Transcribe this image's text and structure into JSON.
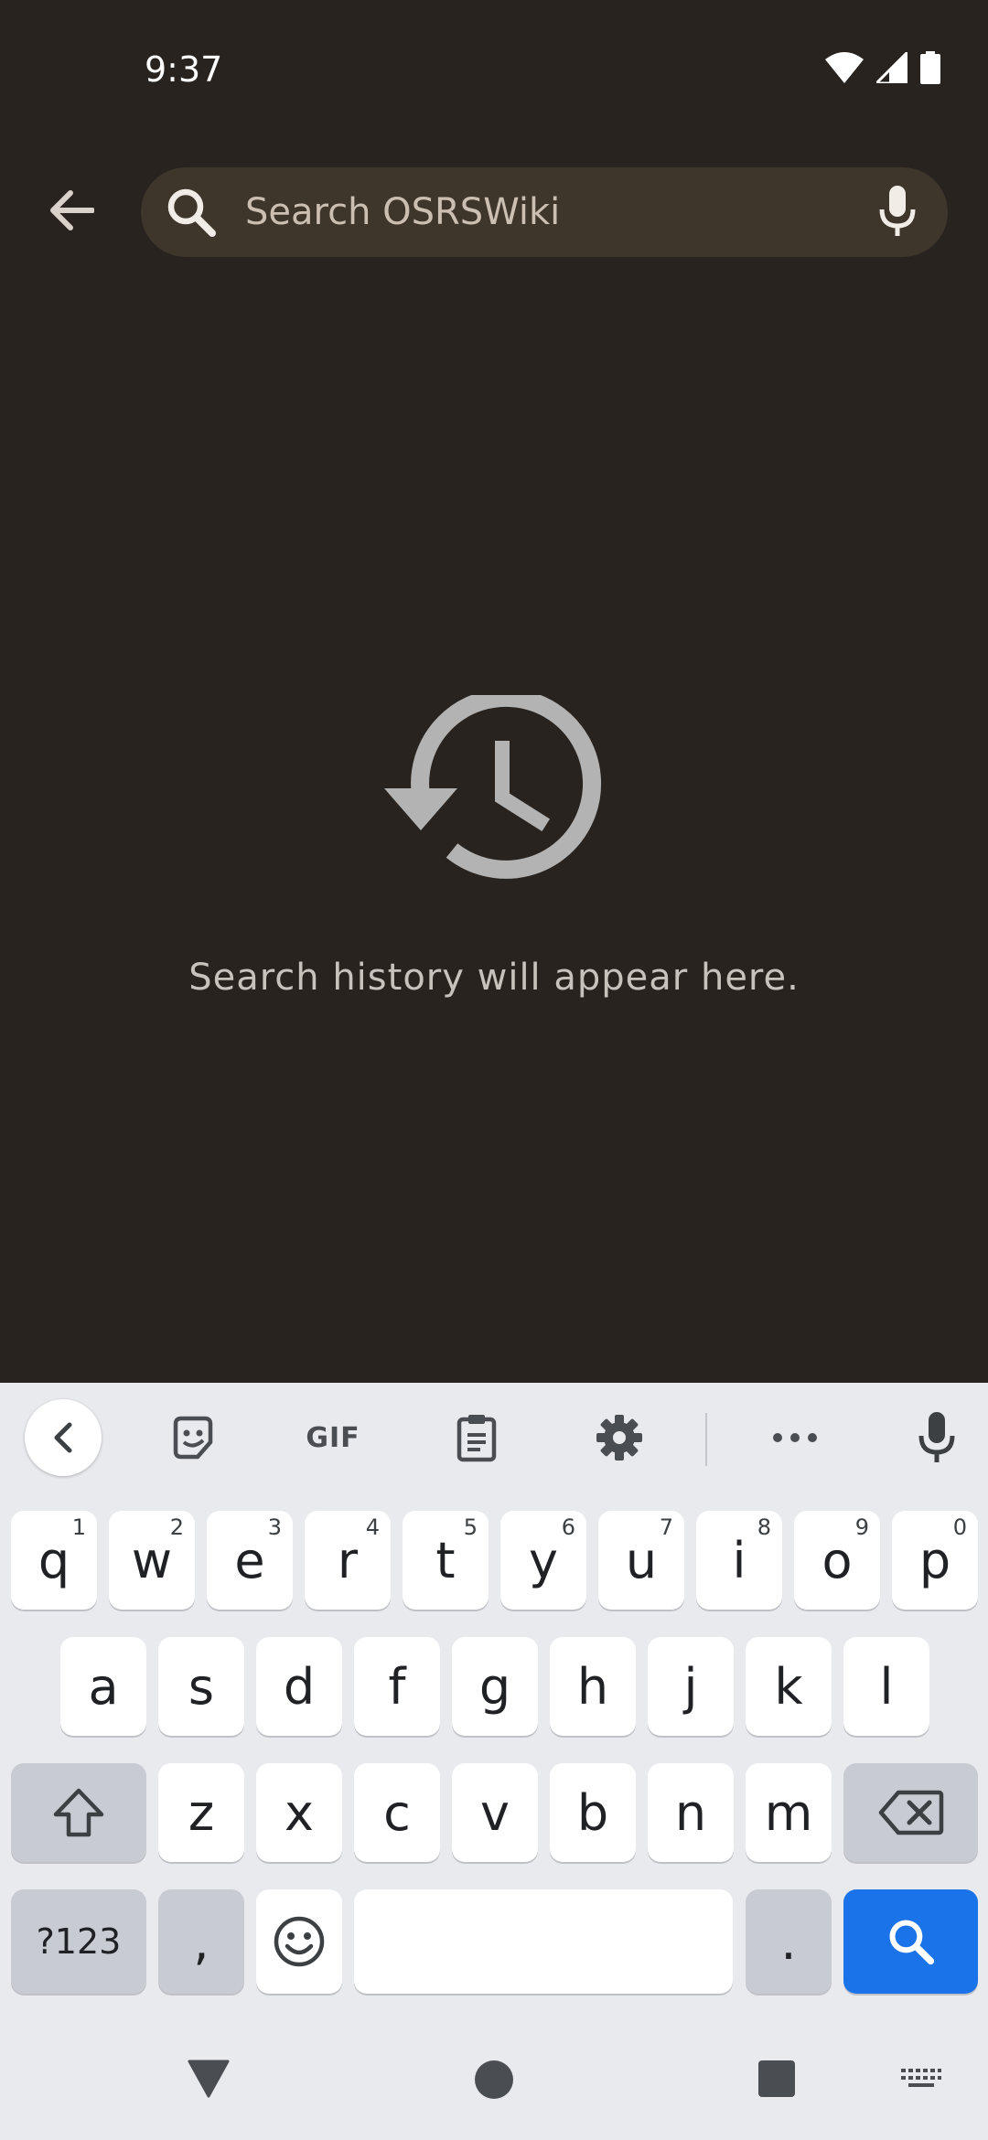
{
  "status_bar": {
    "time": "9:37",
    "icons": [
      "wifi-icon",
      "signal-icon",
      "battery-icon"
    ]
  },
  "search": {
    "placeholder": "Search OSRSWiki",
    "value": "",
    "icons": [
      "back-arrow-icon",
      "search-icon",
      "microphone-icon"
    ]
  },
  "empty_state": {
    "icon": "history-icon",
    "message": "Search history will appear here."
  },
  "keyboard": {
    "toolbar": {
      "items": [
        "chevron-left-icon",
        "sticker-icon",
        "GIF",
        "clipboard-icon",
        "gear-icon",
        "more-icon",
        "microphone-icon"
      ],
      "gif_label": "GIF"
    },
    "row1": [
      {
        "label": "q",
        "hint": "1"
      },
      {
        "label": "w",
        "hint": "2"
      },
      {
        "label": "e",
        "hint": "3"
      },
      {
        "label": "r",
        "hint": "4"
      },
      {
        "label": "t",
        "hint": "5"
      },
      {
        "label": "y",
        "hint": "6"
      },
      {
        "label": "u",
        "hint": "7"
      },
      {
        "label": "i",
        "hint": "8"
      },
      {
        "label": "o",
        "hint": "9"
      },
      {
        "label": "p",
        "hint": "0"
      }
    ],
    "row2": [
      "a",
      "s",
      "d",
      "f",
      "g",
      "h",
      "j",
      "k",
      "l"
    ],
    "row3": [
      "z",
      "x",
      "c",
      "v",
      "b",
      "n",
      "m"
    ],
    "row4": {
      "symbols": "?123",
      "comma": ",",
      "period": "."
    },
    "accent_color": "#1a73e8"
  },
  "nav_bar": {
    "icons": [
      "back-triangle-icon",
      "home-circle-icon",
      "recents-square-icon",
      "keyboard-switch-icon"
    ]
  }
}
